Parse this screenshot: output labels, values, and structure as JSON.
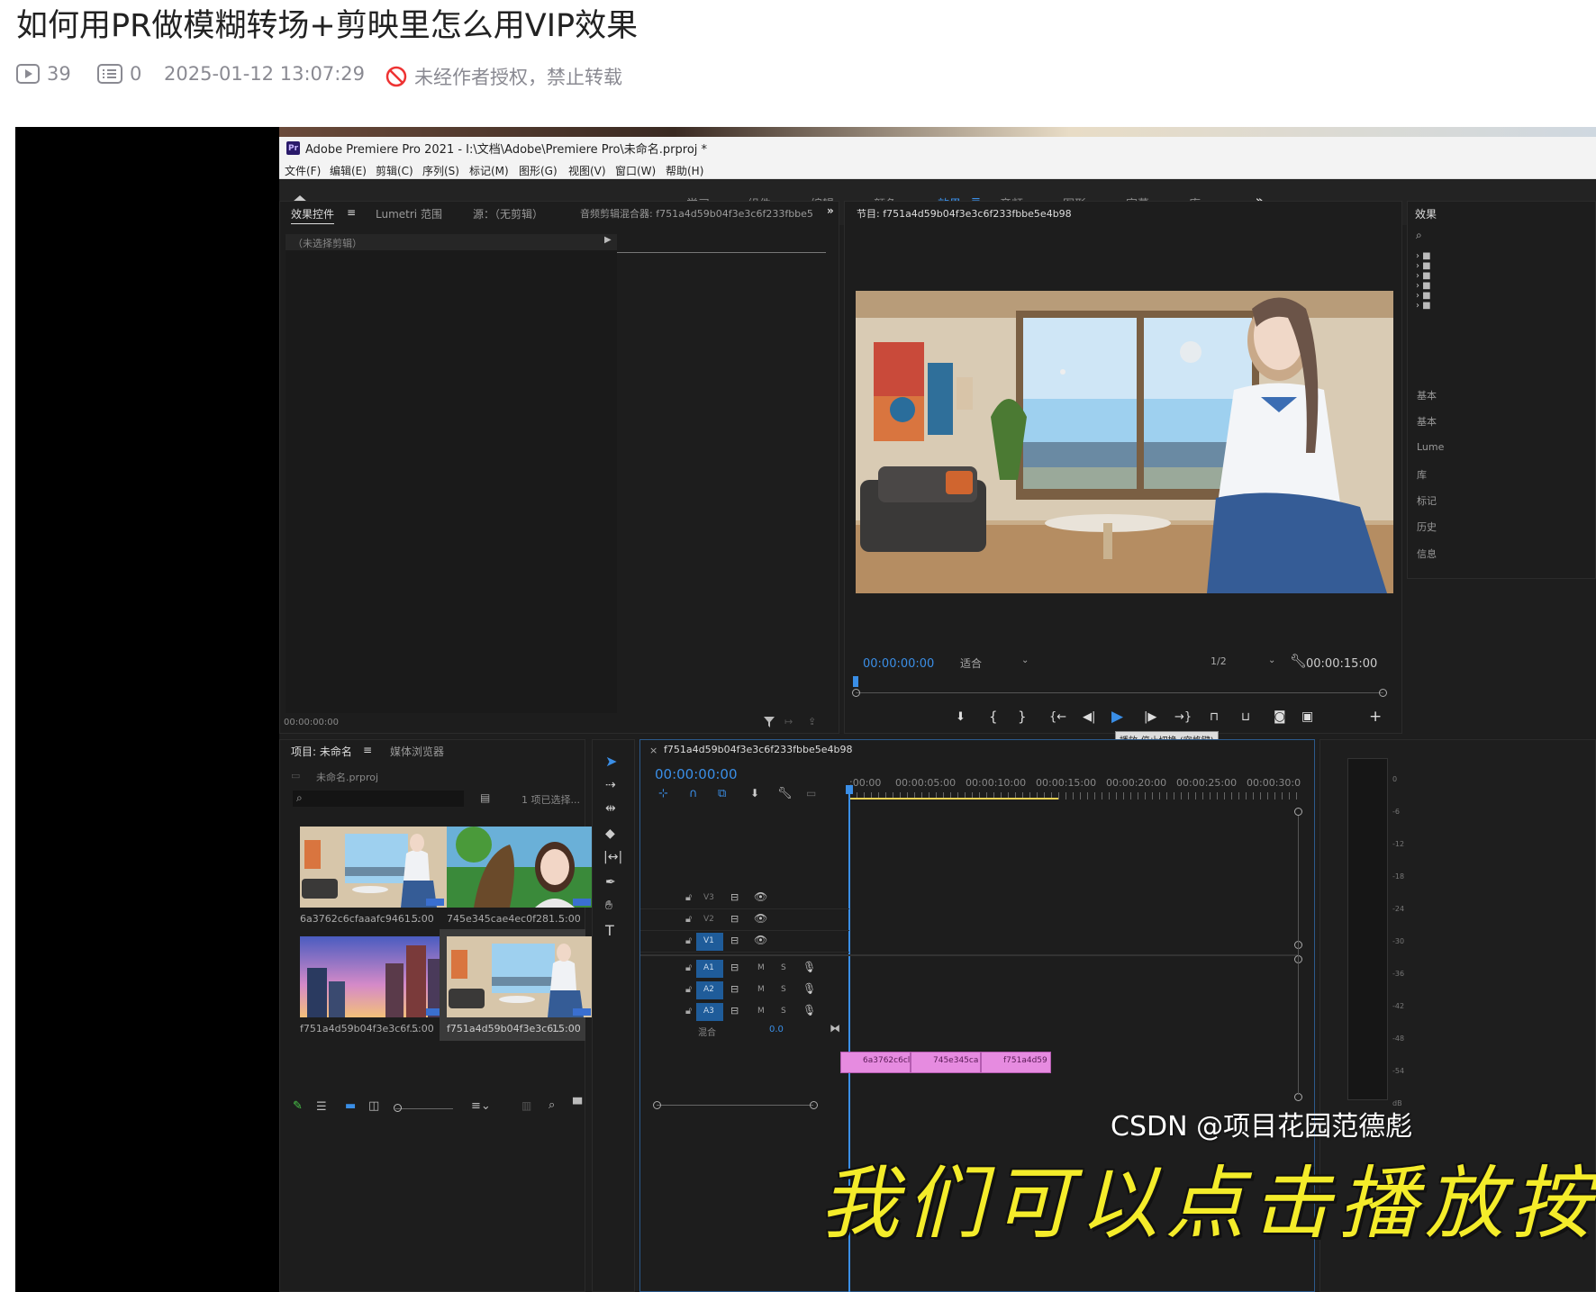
{
  "article": {
    "title": "如何用PR做模糊转场+剪映里怎么用VIP效果",
    "views": "39",
    "comments": "0",
    "datetime": "2025-01-12 13:07:29",
    "copyright": "未经作者授权，禁止转载"
  },
  "premiere": {
    "window_title": "Adobe Premiere Pro 2021 - I:\\文档\\Adobe\\Premiere Pro\\未命名.prproj *",
    "menu": [
      "文件(F)",
      "编辑(E)",
      "剪辑(C)",
      "序列(S)",
      "标记(M)",
      "图形(G)",
      "视图(V)",
      "窗口(W)",
      "帮助(H)"
    ],
    "workspaces": [
      "学习",
      "组件",
      "编辑",
      "颜色",
      "效果",
      "音频",
      "图形",
      "字幕",
      "库"
    ],
    "active_workspace": "效果",
    "source_panel": {
      "tabs": [
        "效果控件",
        "Lumetri 范围",
        "源：（无剪辑）",
        "音频剪辑混合器: f751a4d59b04f3e3c6f233fbbe5"
      ],
      "no_clip": "（未选择剪辑）",
      "timecode": "00:00:00:00"
    },
    "program": {
      "title": "节目: f751a4d59b04f3e3c6f233fbbe5e4b98",
      "timecode": "00:00:00:00",
      "fit": "适合",
      "resolution": "1/2",
      "duration": "00:00:15:00",
      "tooltip": "播放-停止切换 (空格键)"
    },
    "project": {
      "tabs": [
        "项目: 未命名",
        "媒体浏览器"
      ],
      "file": "未命名.prproj",
      "selected": "1 项已选择...",
      "items": [
        {
          "name": "6a3762c6cfaaafc9461...",
          "duration": "5:00"
        },
        {
          "name": "745e345cae4ec0f281...",
          "duration": "5:00"
        },
        {
          "name": "f751a4d59b04f3e3c6f...",
          "duration": "5:00"
        },
        {
          "name": "f751a4d59b04f3e3c6...",
          "duration": "15:00"
        }
      ]
    },
    "timeline": {
      "tab": "f751a4d59b04f3e3c6f233fbbe5e4b98",
      "timecode": "00:00:00:00",
      "ruler": [
        ":00:00",
        "00:00:05:00",
        "00:00:10:00",
        "00:00:15:00",
        "00:00:20:00",
        "00:00:25:00",
        "00:00:30:0"
      ],
      "video_tracks": [
        "V3",
        "V2",
        "V1"
      ],
      "audio_tracks": [
        "A1",
        "A2",
        "A3"
      ],
      "mix_label": "混合",
      "mix_value": "0.0",
      "clips": [
        "6a3762c6cl",
        "745e345ca",
        "f751a4d59"
      ]
    },
    "right_panel": {
      "title": "效果",
      "items": [
        "基本",
        "基本",
        "Lume",
        "库",
        "标记",
        "历史",
        "信息"
      ]
    },
    "meter_scale": [
      "0",
      "-6",
      "-12",
      "-18",
      "-24",
      "-30",
      "-36",
      "-42",
      "-48",
      "-54",
      "dB"
    ]
  },
  "subtitle": "我们可以点击播放按钮",
  "watermark": "CSDN @项目花园范德彪"
}
